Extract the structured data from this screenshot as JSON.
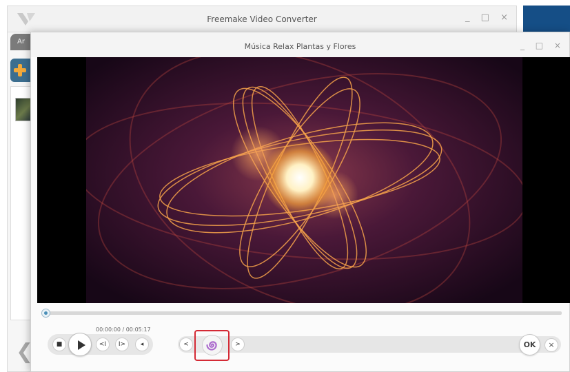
{
  "main_window": {
    "title": "Freemake Video Converter",
    "controls": "_ □ ×",
    "tab_label": "Ar",
    "nav_prev": "❮"
  },
  "player": {
    "title": "Música Relax Plantas y Flores",
    "controls": "_ □ ×",
    "time_display": "00:00:00 / 00:05:17",
    "progress": 0,
    "buttons": {
      "stop": "■",
      "frame_back": "<I",
      "frame_forward": "I>",
      "volume": "◂",
      "thumb_prev": "<",
      "thumb_next": ">",
      "ok": "OK",
      "close": "×"
    }
  },
  "colors": {
    "accent_blue": "#154e86",
    "highlight_red": "#d42a35",
    "effect_purple": "#a35cc9"
  }
}
